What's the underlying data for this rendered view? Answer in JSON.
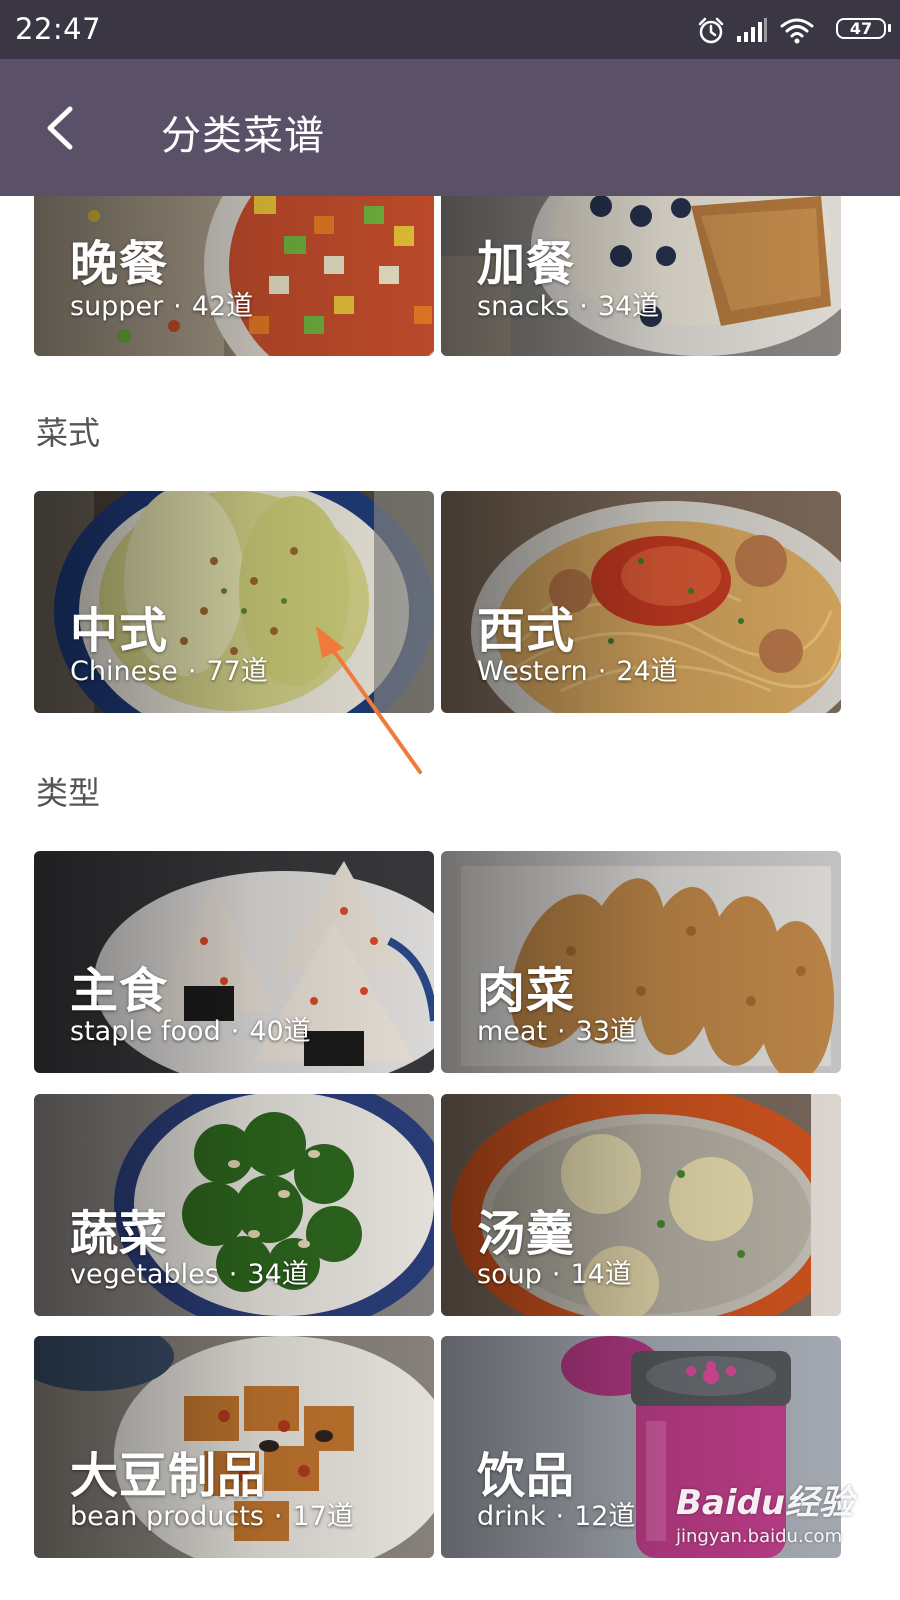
{
  "status": {
    "time": "22:47",
    "battery": "47"
  },
  "header": {
    "title": "分类菜谱"
  },
  "sections": {
    "style": "菜式",
    "type": "类型"
  },
  "cards": {
    "supper": {
      "title": "晚餐",
      "en": "supper",
      "count": "42道"
    },
    "snacks": {
      "title": "加餐",
      "en": "snacks",
      "count": "34道"
    },
    "chinese": {
      "title": "中式",
      "en": "Chinese",
      "count": "77道"
    },
    "western": {
      "title": "西式",
      "en": "Western",
      "count": "24道"
    },
    "staple": {
      "title": "主食",
      "en": "staple food",
      "count": "40道"
    },
    "meat": {
      "title": "肉菜",
      "en": "meat",
      "count": "33道"
    },
    "vegetables": {
      "title": "蔬菜",
      "en": "vegetables",
      "count": "34道"
    },
    "soup": {
      "title": "汤羹",
      "en": "soup",
      "count": "14道"
    },
    "bean": {
      "title": "大豆制品",
      "en": "bean products",
      "count": "17道"
    },
    "drink": {
      "title": "饮品",
      "en": "drink",
      "count": "12道"
    }
  },
  "separator": "·",
  "watermark": {
    "main": "Baidu经验",
    "sub": "jingyan.baidu.com"
  },
  "colors": {
    "status_bar": "#3b3644",
    "app_bar": "#5a5068",
    "annotation_arrow": "#f07a3a"
  }
}
